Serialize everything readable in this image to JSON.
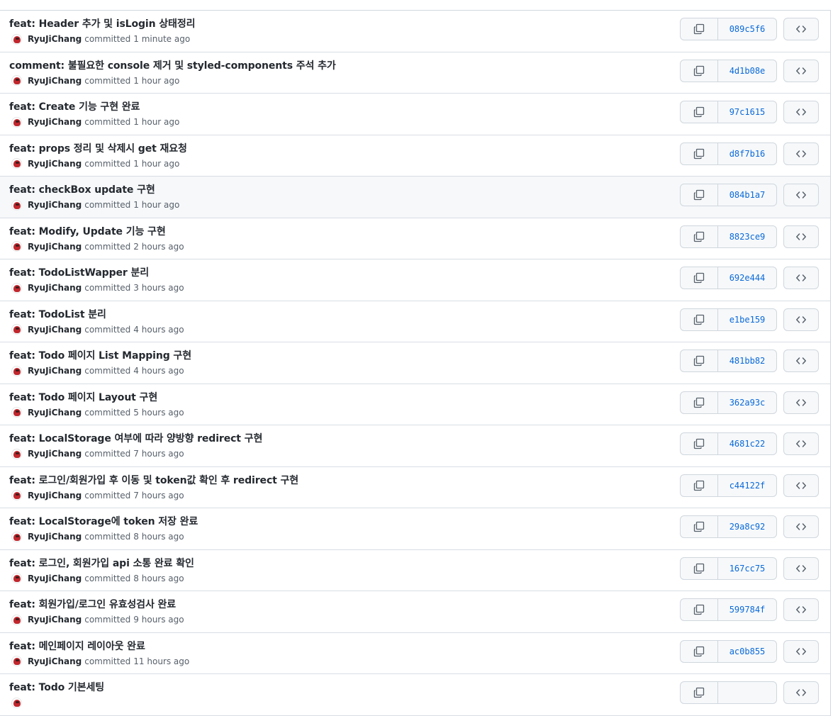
{
  "commits": [
    {
      "title": "feat: Header 추가 및 isLogin 상태정리",
      "author": "RyuJiChang",
      "committed": "committed",
      "time": "1 minute ago",
      "sha": "089c5f6"
    },
    {
      "title": "comment: 불필요한 console 제거 및 styled-components 주석 추가",
      "author": "RyuJiChang",
      "committed": "committed",
      "time": "1 hour ago",
      "sha": "4d1b08e"
    },
    {
      "title": "feat: Create 기능 구현 완료",
      "author": "RyuJiChang",
      "committed": "committed",
      "time": "1 hour ago",
      "sha": "97c1615"
    },
    {
      "title": "feat: props 정리 및 삭제시 get 재요청",
      "author": "RyuJiChang",
      "committed": "committed",
      "time": "1 hour ago",
      "sha": "d8f7b16"
    },
    {
      "title": "feat: checkBox update 구현",
      "author": "RyuJiChang",
      "committed": "committed",
      "time": "1 hour ago",
      "sha": "084b1a7"
    },
    {
      "title": "feat: Modify, Update 기능 구현",
      "author": "RyuJiChang",
      "committed": "committed",
      "time": "2 hours ago",
      "sha": "8823ce9"
    },
    {
      "title": "feat: TodoListWapper 분리",
      "author": "RyuJiChang",
      "committed": "committed",
      "time": "3 hours ago",
      "sha": "692e444"
    },
    {
      "title": "feat: TodoList 분리",
      "author": "RyuJiChang",
      "committed": "committed",
      "time": "4 hours ago",
      "sha": "e1be159"
    },
    {
      "title": "feat: Todo 페이지 List Mapping 구현",
      "author": "RyuJiChang",
      "committed": "committed",
      "time": "4 hours ago",
      "sha": "481bb82"
    },
    {
      "title": "feat: Todo 페이지 Layout 구현",
      "author": "RyuJiChang",
      "committed": "committed",
      "time": "5 hours ago",
      "sha": "362a93c"
    },
    {
      "title": "feat: LocalStorage 여부에 따라 양방향 redirect 구현",
      "author": "RyuJiChang",
      "committed": "committed",
      "time": "7 hours ago",
      "sha": "4681c22"
    },
    {
      "title": "feat: 로그인/회원가입 후 이동 및 token값 확인 후 redirect 구현",
      "author": "RyuJiChang",
      "committed": "committed",
      "time": "7 hours ago",
      "sha": "c44122f"
    },
    {
      "title": "feat: LocalStorage에 token 저장 완료",
      "author": "RyuJiChang",
      "committed": "committed",
      "time": "8 hours ago",
      "sha": "29a8c92"
    },
    {
      "title": "feat: 로그인, 회원가입 api 소통 완료 확인",
      "author": "RyuJiChang",
      "committed": "committed",
      "time": "8 hours ago",
      "sha": "167cc75"
    },
    {
      "title": "feat: 회원가입/로그인 유효성검사 완료",
      "author": "RyuJiChang",
      "committed": "committed",
      "time": "9 hours ago",
      "sha": "599784f"
    },
    {
      "title": "feat: 메인페이지 레이아웃 완료",
      "author": "RyuJiChang",
      "committed": "committed",
      "time": "11 hours ago",
      "sha": "ac0b855"
    },
    {
      "title": "feat: Todo 기본세팅",
      "author": "",
      "committed": "",
      "time": "",
      "sha": ""
    }
  ],
  "highlighted_row": 4,
  "icons": {
    "copy": "copy-icon",
    "browse": "code-icon",
    "avatar": "avatar"
  },
  "colors": {
    "sha": "#0969da",
    "border": "#d0d7de",
    "button_bg": "#f6f8fa",
    "highlight_bg": "#f6f8fa"
  }
}
